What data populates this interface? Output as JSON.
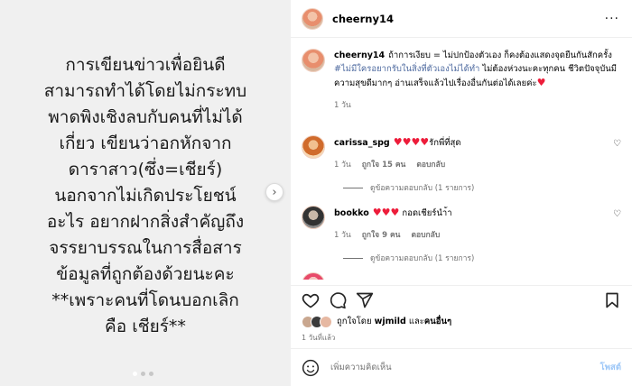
{
  "media": {
    "text": "การเขียนข่าวเพื่อยินดี\nสามารถทำได้โดยไม่กระทบ\nพาดพิงเชิงลบกับคนที่ไม่ได้\nเกี่ยว เขียนว่าอกหักจาก\nดาราสาว(ซึ่ง=เชียร์)\nนอกจากไม่เกิดประโยชน์\nอะไร อยากฝากสิ่งสำคัญถึง\nจรรยาบรรณในการสื่อสาร\nข้อมูลที่ถูกต้องด้วยนะคะ\n**เพราะคนที่โดนบอกเลิก\nคือ เชียร์**",
    "next_glyph": "›"
  },
  "header": {
    "username": "cheerny14",
    "more": "···"
  },
  "caption": {
    "username": "cheerny14",
    "text_a": "ถ้าการเงียบ = ไม่ปกป้องตัวเอง ก็คงต้องแสดงจุดยืนกันสักครั้ง ",
    "hashtag": "#ไม่มีใครอยากรับในสิ่งที่ตัวเองไม่ได้ทำ",
    "text_b": " ไม่ต้องห่วงนะคะทุกคน ชีวิตปัจจุบันมีความสุขดีมากๆ อ่านเสร็จแล้วไปเรื่องอื่นกันต่อได้เลยค่ะ",
    "heart": "♥",
    "time": "1 วัน"
  },
  "comments": [
    {
      "username": "carissa_spg",
      "text": "รักพี่ที่สุด",
      "hearts": "♥♥♥♥",
      "time": "1 วัน",
      "likes": "ถูกใจ 15 คน",
      "reply": "ตอบกลับ",
      "view_replies": "ดูข้อความตอบกลับ (1 รายการ)"
    },
    {
      "username": "bookko",
      "text": "กอดเชียร์นำ้า",
      "hearts": "♥♥♥",
      "time": "1 วัน",
      "likes": "ถูกใจ 9 คน",
      "reply": "ตอบกลับ",
      "view_replies": "ดูข้อความตอบกลับ (1 รายการ)"
    }
  ],
  "likes_line": {
    "prefix": "ถูกใจโดย ",
    "user": "wjmild",
    "mid": " และ",
    "others": "คนอื่นๆ"
  },
  "date": "1 วันที่แล้ว",
  "composer": {
    "placeholder": "เพิ่มความคิดเห็น",
    "post": "โพสต์"
  },
  "colors": {
    "accent": "#0095f6",
    "heart": "#ed1c3a",
    "hashtag": "#4f6ba0"
  }
}
